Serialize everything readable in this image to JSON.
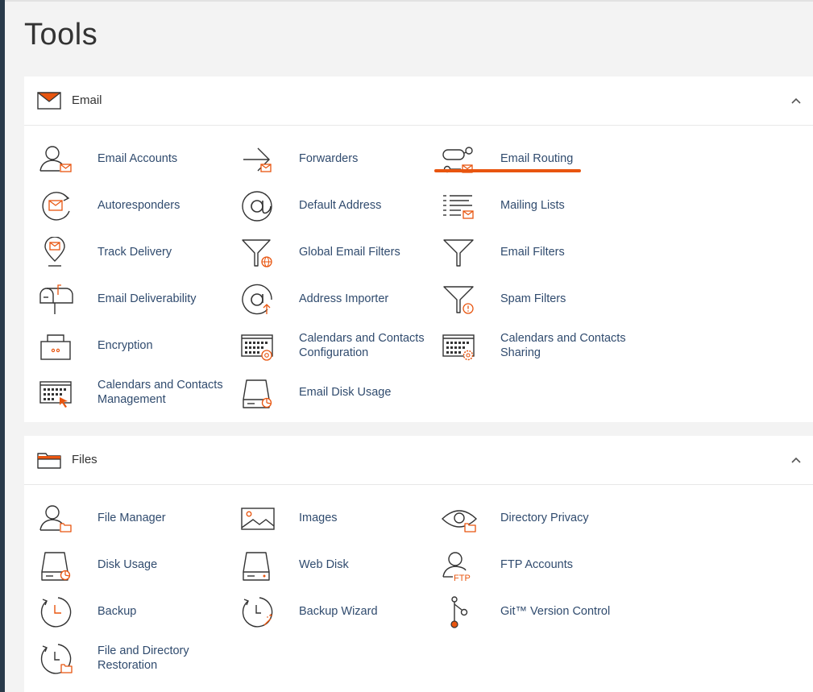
{
  "page": {
    "title": "Tools"
  },
  "colors": {
    "accent": "#e8550f",
    "link": "#304b6e",
    "sidebar": "#293a4a"
  },
  "email": {
    "title": "Email",
    "icon": "envelope-icon",
    "tools": [
      {
        "label": "Email Accounts",
        "icon": "user-mail-icon"
      },
      {
        "label": "Forwarders",
        "icon": "forward-arrow-icon"
      },
      {
        "label": "Email Routing",
        "icon": "routing-icon"
      },
      {
        "label": "Autoresponders",
        "icon": "autoresponder-icon"
      },
      {
        "label": "Default Address",
        "icon": "at-sign-icon"
      },
      {
        "label": "Mailing Lists",
        "icon": "list-mail-icon"
      },
      {
        "label": "Track Delivery",
        "icon": "location-pin-mail-icon"
      },
      {
        "label": "Global Email Filters",
        "icon": "funnel-globe-icon"
      },
      {
        "label": "Email Filters",
        "icon": "funnel-icon"
      },
      {
        "label": "Email Deliverability",
        "icon": "mailbox-icon"
      },
      {
        "label": "Address Importer",
        "icon": "at-import-icon"
      },
      {
        "label": "Spam Filters",
        "icon": "funnel-warning-icon"
      },
      {
        "label": "Encryption",
        "icon": "lock-icon"
      },
      {
        "label": "Calendars and Contacts Configuration",
        "icon": "calendar-at-icon"
      },
      {
        "label": "Calendars and Contacts Sharing",
        "icon": "calendar-gear-icon"
      },
      {
        "label": "Calendars and Contacts Management",
        "icon": "calendar-cursor-icon"
      },
      {
        "label": "Email Disk Usage",
        "icon": "disk-pie-icon"
      }
    ]
  },
  "files": {
    "title": "Files",
    "icon": "folder-icon",
    "tools": [
      {
        "label": "File Manager",
        "icon": "user-folder-icon"
      },
      {
        "label": "Images",
        "icon": "image-icon"
      },
      {
        "label": "Directory Privacy",
        "icon": "eye-folder-icon"
      },
      {
        "label": "Disk Usage",
        "icon": "disk-pie-icon"
      },
      {
        "label": "Web Disk",
        "icon": "disk-icon"
      },
      {
        "label": "FTP Accounts",
        "icon": "user-ftp-icon"
      },
      {
        "label": "Backup",
        "icon": "clock-restore-icon"
      },
      {
        "label": "Backup Wizard",
        "icon": "clock-wand-icon"
      },
      {
        "label": "Git™ Version Control",
        "icon": "git-branch-icon"
      },
      {
        "label": "File and Directory Restoration",
        "icon": "clock-folder-icon"
      }
    ],
    "ftp_badge": "FTP"
  }
}
